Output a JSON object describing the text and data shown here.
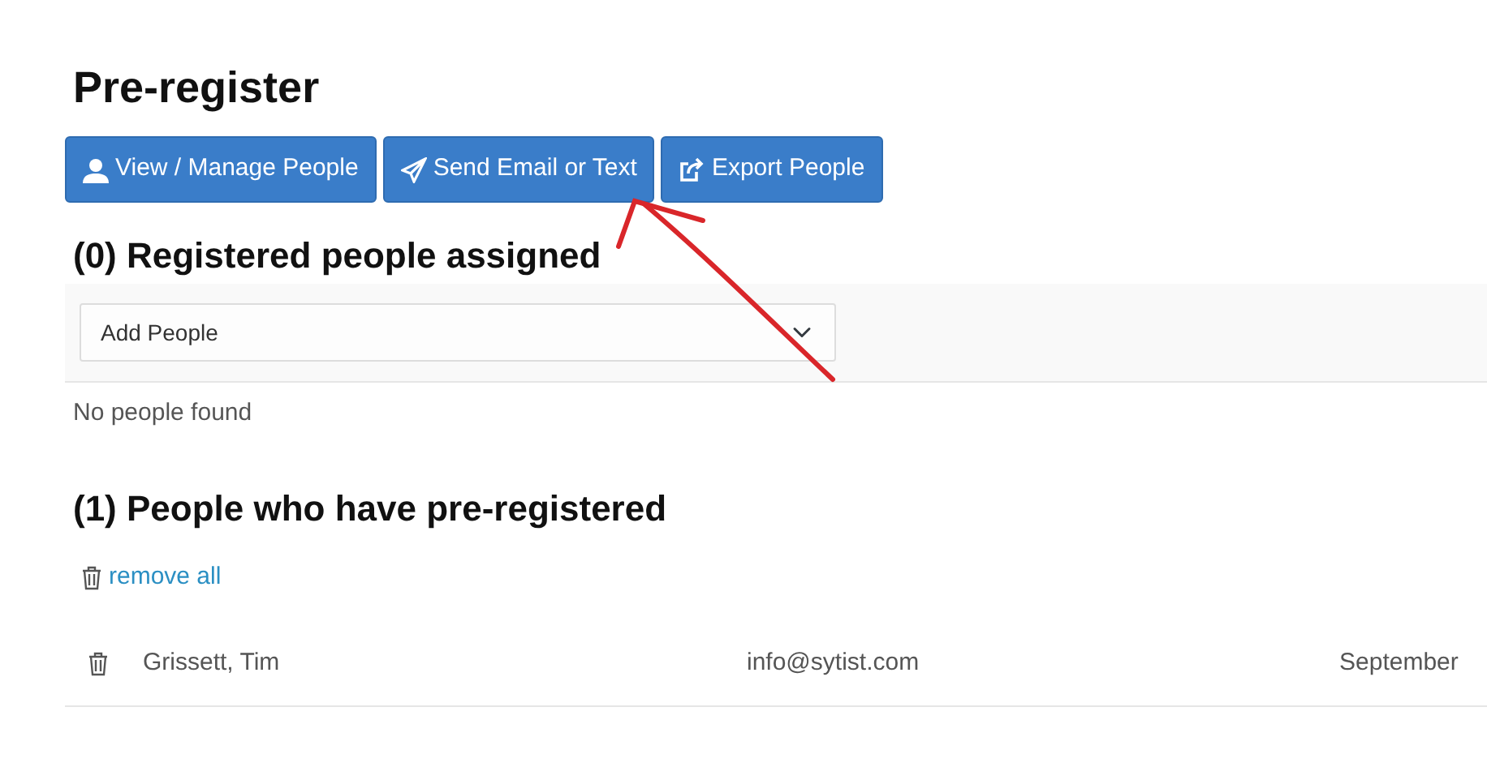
{
  "page_title": "Pre-register",
  "buttons": [
    {
      "label": "View / Manage People"
    },
    {
      "label": "Send Email or Text"
    },
    {
      "label": "Export People"
    }
  ],
  "assigned": {
    "heading": "(0) Registered people assigned",
    "select": {
      "value": "Add People"
    },
    "empty_message": "No people found"
  },
  "preregistered": {
    "heading": "(1) People who have pre-registered",
    "remove_all": "remove all",
    "rows": [
      {
        "name": "Grissett, Tim",
        "email": "info@sytist.com",
        "date": "September"
      }
    ]
  }
}
